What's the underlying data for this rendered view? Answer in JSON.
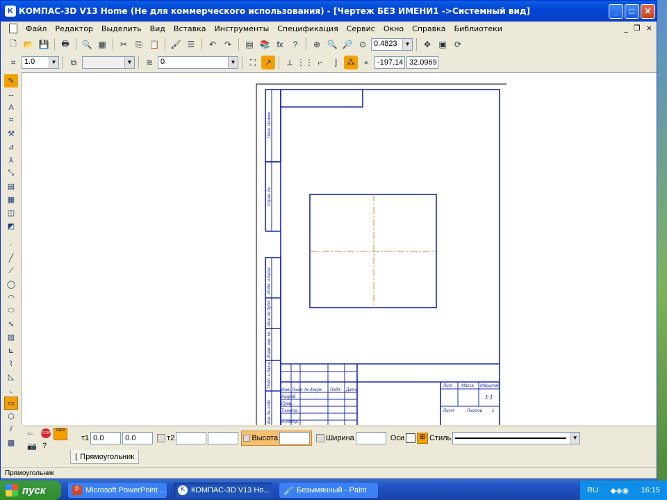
{
  "window": {
    "title": "КОМПАС-3D V13 Home (Не для коммерческого использования) - [Чертеж БЕЗ ИМЕНИ1 ->Системный вид]",
    "app_icon": "kompas-icon",
    "minimize": "_",
    "maximize": "□",
    "close": "✕"
  },
  "menu": [
    "Файл",
    "Редактор",
    "Выделить",
    "Вид",
    "Вставка",
    "Инструменты",
    "Спецификация",
    "Сервис",
    "Окно",
    "Справка",
    "Библиотеки"
  ],
  "mdi_controls": {
    "min": "_",
    "restore": "❐",
    "close": "×"
  },
  "toolbar1": {
    "zoom": "0.4823"
  },
  "toolbar2": {
    "scale": "1.0",
    "style_combo": "",
    "layer": "0",
    "coord_x": "-197.14",
    "coord_y": "32.0969"
  },
  "drawing_sheet": {
    "side_labels": [
      "Перв. примен.",
      "Справ. №",
      "Подп. и дата",
      "Инв. № дубл.",
      "Взам. инв. №",
      "Подп. и дата",
      "Инв. № подл."
    ],
    "title_block": {
      "liter": "Лит.",
      "mass": "Масса",
      "scale": "Масштаб",
      "scale_val": "1:1",
      "sheet": "Лист",
      "sheets": "Листов",
      "sheets_val": "1",
      "rows": [
        "Изм.",
        "Лист",
        "№ докум.",
        "Подп.",
        "Дата"
      ],
      "row_labels": [
        "Разраб.",
        "Пров.",
        "Т.контр.",
        "Н.контр."
      ]
    }
  },
  "propbar": {
    "t1_label": "т1",
    "t1_x": "0.0",
    "t1_y": "0.0",
    "t2_label": "т2",
    "t2_x": "",
    "t2_y": "",
    "height_label": "Высота",
    "height_value": "",
    "width_label": "Ширина",
    "width_value": "",
    "axes_label": "Оси",
    "style_label": "Стиль",
    "stop_label": "STOP",
    "auto_label": "Авто"
  },
  "tab": {
    "label": "Прямоугольник"
  },
  "status": {
    "text": "Прямоугольник"
  },
  "taskbar": {
    "start": "пуск",
    "tasks": [
      {
        "label": "Microsoft PowerPoint ..."
      },
      {
        "label": "КОМПАС-3D V13 Ho..."
      },
      {
        "label": "Безымянный - Paint"
      }
    ],
    "lang": "RU",
    "clock": "16:15"
  },
  "colors": {
    "drawing_blue": "#1a2aa8",
    "axis_orange": "#d08a2a",
    "titlebar": "#0a5fe0"
  }
}
